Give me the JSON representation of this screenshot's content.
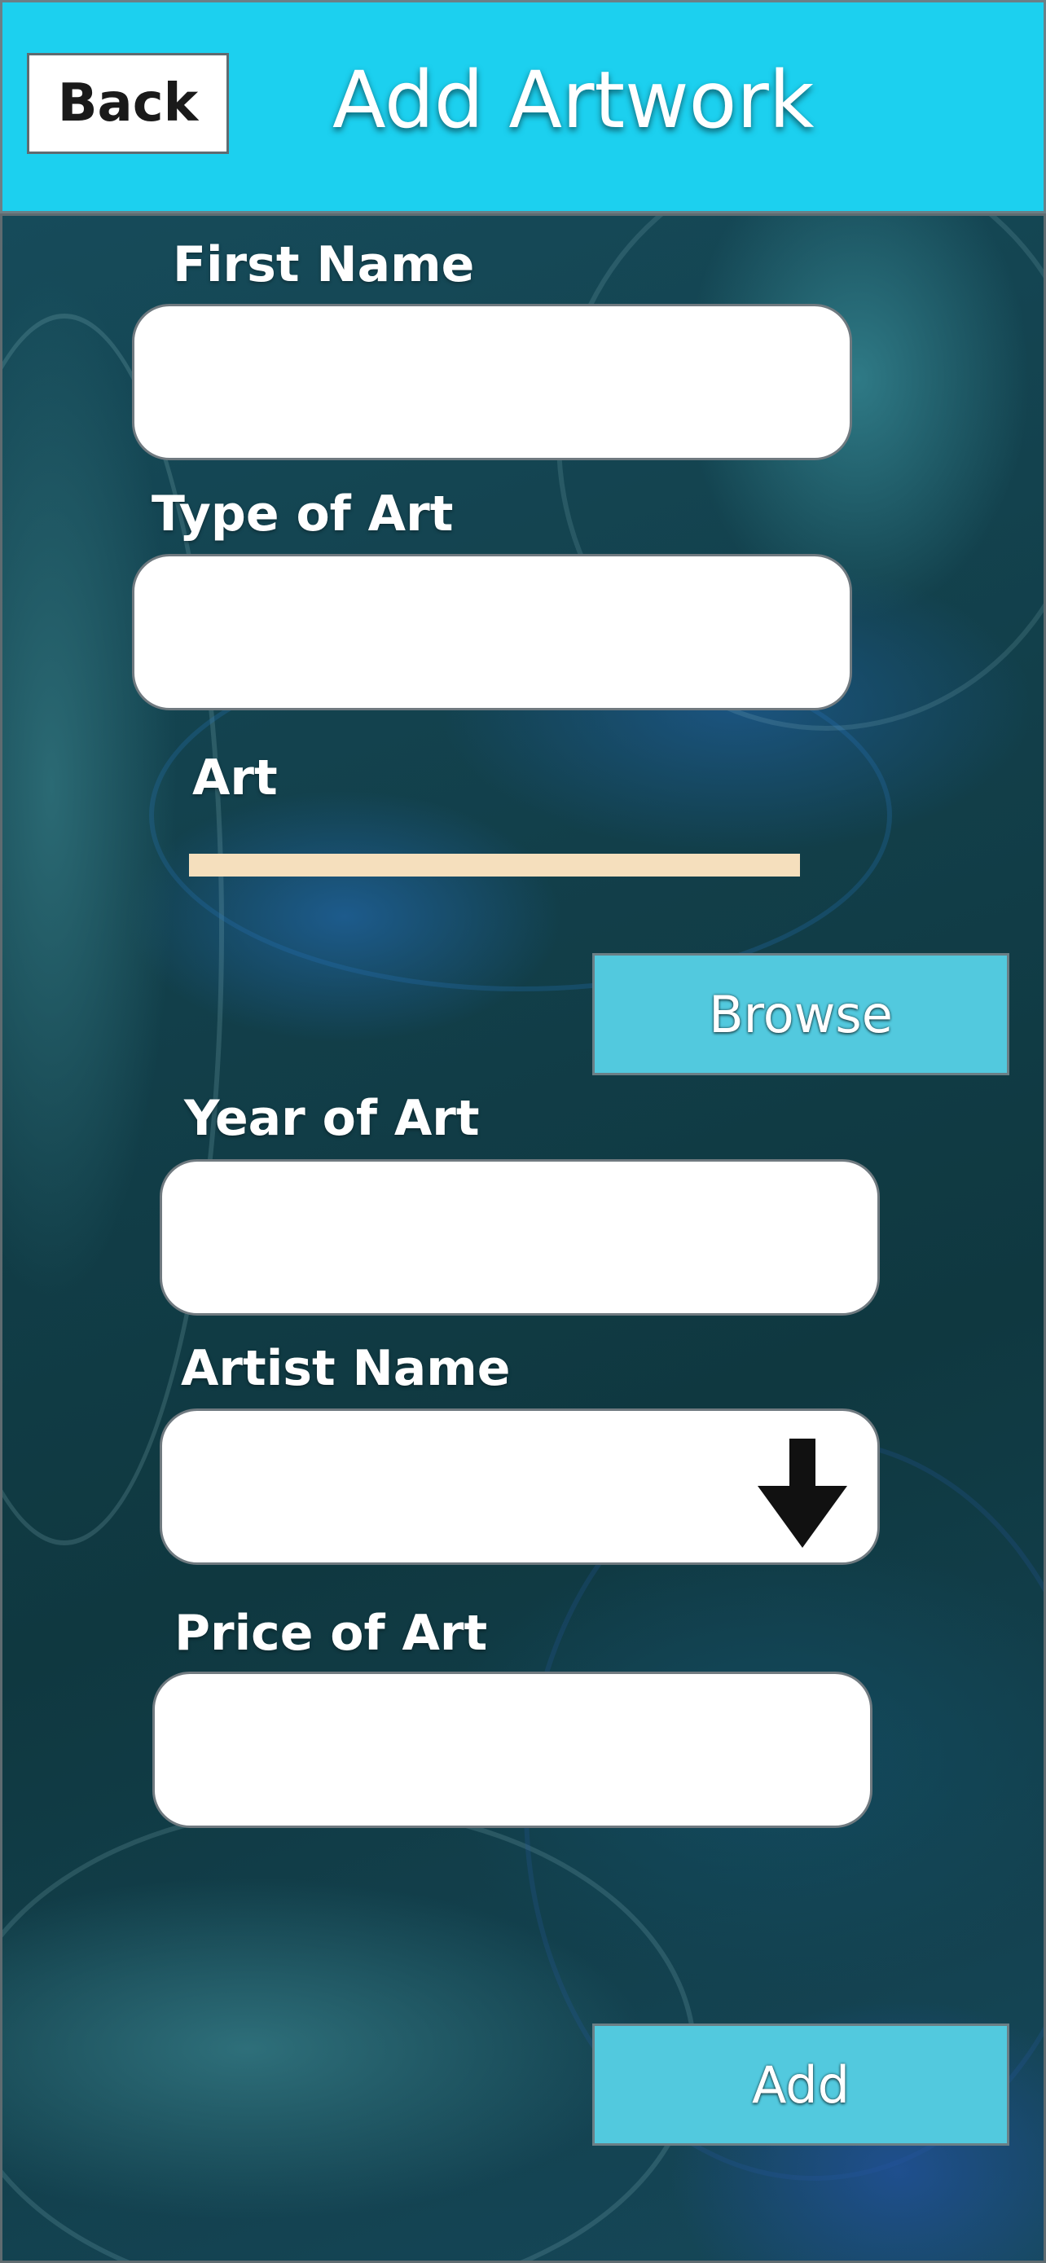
{
  "header": {
    "back_label": "Back",
    "title": "Add Artwork"
  },
  "form": {
    "first_name": {
      "label": "First Name",
      "value": ""
    },
    "type_of_art": {
      "label": "Type of Art",
      "value": ""
    },
    "art": {
      "label": "Art"
    },
    "browse_label": "Browse",
    "year_of_art": {
      "label": "Year of Art",
      "value": ""
    },
    "artist_name": {
      "label": "Artist Name",
      "selected": "",
      "icon": "dropdown-arrow-icon"
    },
    "price_of_art": {
      "label": "Price of Art",
      "value": ""
    },
    "add_label": "Add"
  },
  "colors": {
    "header_bg": "#1cd0ef",
    "button_bg": "#52c9de",
    "art_bar": "#f5dfbd"
  }
}
